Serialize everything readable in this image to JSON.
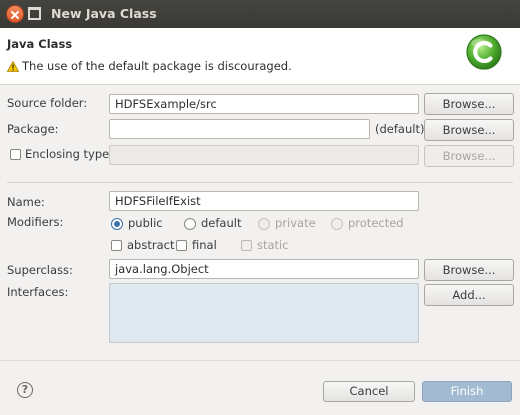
{
  "window": {
    "title": "New Java Class"
  },
  "header": {
    "title": "Java Class",
    "message": "The use of the default package is discouraged.",
    "message_icon": "warning-icon",
    "logo_icon": "java-class-logo-icon",
    "accent_color": "#4aa02c"
  },
  "form": {
    "source_folder": {
      "label": "Source folder:",
      "value": "HDFSExample/src",
      "button": "Browse..."
    },
    "package": {
      "label": "Package:",
      "value": "",
      "suffix": "(default)",
      "button": "Browse..."
    },
    "enclosing_type": {
      "label": "Enclosing type:",
      "value": "",
      "checked": false,
      "button": "Browse..."
    },
    "name": {
      "label": "Name:",
      "value": "HDFSFileIfExist"
    },
    "modifiers": {
      "label": "Modifiers:",
      "access": [
        {
          "label": "public",
          "selected": true,
          "enabled": true
        },
        {
          "label": "default",
          "selected": false,
          "enabled": true
        },
        {
          "label": "private",
          "selected": false,
          "enabled": false
        },
        {
          "label": "protected",
          "selected": false,
          "enabled": false
        }
      ],
      "flags": [
        {
          "label": "abstract",
          "checked": false,
          "enabled": true
        },
        {
          "label": "final",
          "checked": false,
          "enabled": true
        },
        {
          "label": "static",
          "checked": false,
          "enabled": false
        }
      ]
    },
    "superclass": {
      "label": "Superclass:",
      "value": "java.lang.Object",
      "button": "Browse..."
    },
    "interfaces": {
      "label": "Interfaces:",
      "button": "Add..."
    }
  },
  "footer": {
    "help_icon": "help-icon",
    "help_glyph": "?",
    "cancel": "Cancel",
    "finish": "Finish"
  }
}
